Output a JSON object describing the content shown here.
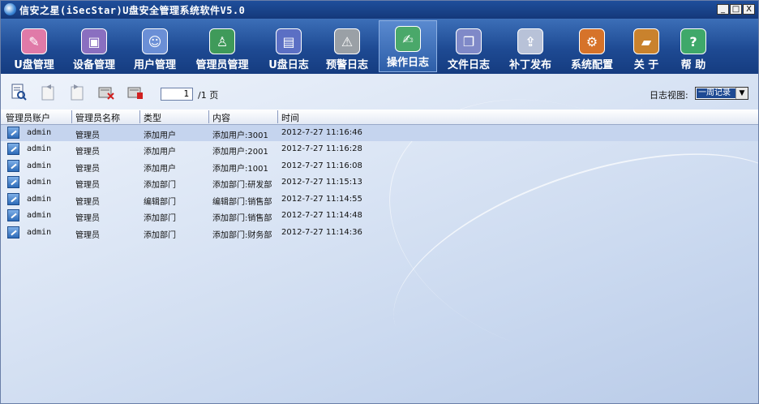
{
  "window": {
    "title": "信安之星(iSecStar)U盘安全管理系统软件V5.0",
    "controls": {
      "minimize": "_",
      "maximize": "□",
      "close": "X"
    }
  },
  "toolbar": {
    "items": [
      {
        "label": "U盘管理",
        "icon": "usb-manage-icon",
        "color": "#e07aa8"
      },
      {
        "label": "设备管理",
        "icon": "device-manage-icon",
        "color": "#8a6fc0"
      },
      {
        "label": "用户管理",
        "icon": "user-manage-icon",
        "color": "#6b8fd6"
      },
      {
        "label": "管理员管理",
        "icon": "admin-manage-icon",
        "color": "#3f9a5a"
      },
      {
        "label": "U盘日志",
        "icon": "usb-log-icon",
        "color": "#5b6fc4"
      },
      {
        "label": "预警日志",
        "icon": "warning-log-icon",
        "color": "#9aa0a6"
      },
      {
        "label": "操作日志",
        "icon": "operation-log-icon",
        "color": "#4aa86a"
      },
      {
        "label": "文件日志",
        "icon": "file-log-icon",
        "color": "#7f89c8"
      },
      {
        "label": "补丁发布",
        "icon": "patch-publish-icon",
        "color": "#b8c2d8"
      },
      {
        "label": "系统配置",
        "icon": "system-config-icon",
        "color": "#d6732a"
      },
      {
        "label": "关 于",
        "icon": "about-icon",
        "color": "#c9822d"
      },
      {
        "label": "帮 助",
        "icon": "help-icon",
        "color": "#3fa86a"
      }
    ],
    "active_index": 6
  },
  "pager": {
    "current_page": "1",
    "total_text": "/1 页"
  },
  "log_view": {
    "label": "日志视图:",
    "selected": "一周记录"
  },
  "table": {
    "columns": [
      "管理员账户",
      "管理员名称",
      "类型",
      "内容",
      "时间"
    ],
    "rows": [
      {
        "account": "admin",
        "name": "管理员",
        "type": "添加用户",
        "content": "添加用户:3001",
        "time": "2012-7-27 11:16:46"
      },
      {
        "account": "admin",
        "name": "管理员",
        "type": "添加用户",
        "content": "添加用户:2001",
        "time": "2012-7-27 11:16:28"
      },
      {
        "account": "admin",
        "name": "管理员",
        "type": "添加用户",
        "content": "添加用户:1001",
        "time": "2012-7-27 11:16:08"
      },
      {
        "account": "admin",
        "name": "管理员",
        "type": "添加部门",
        "content": "添加部门:研发部",
        "time": "2012-7-27 11:15:13"
      },
      {
        "account": "admin",
        "name": "管理员",
        "type": "编辑部门",
        "content": "编辑部门:销售部",
        "time": "2012-7-27 11:14:55"
      },
      {
        "account": "admin",
        "name": "管理员",
        "type": "添加部门",
        "content": "添加部门:销售部",
        "time": "2012-7-27 11:14:48"
      },
      {
        "account": "admin",
        "name": "管理员",
        "type": "添加部门",
        "content": "添加部门:财务部",
        "time": "2012-7-27 11:14:36"
      }
    ],
    "selected_row": 0
  }
}
